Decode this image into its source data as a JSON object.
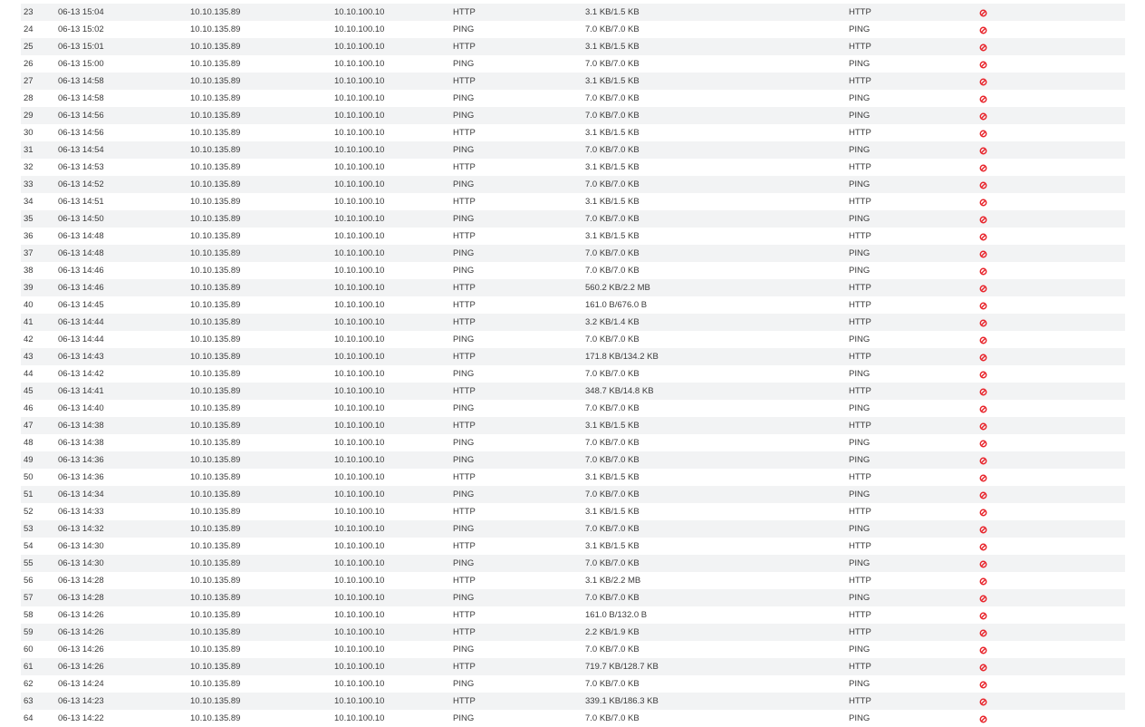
{
  "colors": {
    "stripe": "#f2f3f4",
    "text": "#3a3a3a",
    "blocked_icon": "#e8242b"
  },
  "icons": {
    "action": "blocked-icon"
  },
  "rows": [
    {
      "idx": "23",
      "time": "06-13 15:04",
      "src": "10.10.135.89",
      "dst": "10.10.100.10",
      "protocol": "HTTP",
      "bytes": "3.1 KB/1.5 KB",
      "app": "HTTP"
    },
    {
      "idx": "24",
      "time": "06-13 15:02",
      "src": "10.10.135.89",
      "dst": "10.10.100.10",
      "protocol": "PING",
      "bytes": "7.0 KB/7.0 KB",
      "app": "PING"
    },
    {
      "idx": "25",
      "time": "06-13 15:01",
      "src": "10.10.135.89",
      "dst": "10.10.100.10",
      "protocol": "HTTP",
      "bytes": "3.1 KB/1.5 KB",
      "app": "HTTP"
    },
    {
      "idx": "26",
      "time": "06-13 15:00",
      "src": "10.10.135.89",
      "dst": "10.10.100.10",
      "protocol": "PING",
      "bytes": "7.0 KB/7.0 KB",
      "app": "PING"
    },
    {
      "idx": "27",
      "time": "06-13 14:58",
      "src": "10.10.135.89",
      "dst": "10.10.100.10",
      "protocol": "HTTP",
      "bytes": "3.1 KB/1.5 KB",
      "app": "HTTP"
    },
    {
      "idx": "28",
      "time": "06-13 14:58",
      "src": "10.10.135.89",
      "dst": "10.10.100.10",
      "protocol": "PING",
      "bytes": "7.0 KB/7.0 KB",
      "app": "PING"
    },
    {
      "idx": "29",
      "time": "06-13 14:56",
      "src": "10.10.135.89",
      "dst": "10.10.100.10",
      "protocol": "PING",
      "bytes": "7.0 KB/7.0 KB",
      "app": "PING"
    },
    {
      "idx": "30",
      "time": "06-13 14:56",
      "src": "10.10.135.89",
      "dst": "10.10.100.10",
      "protocol": "HTTP",
      "bytes": "3.1 KB/1.5 KB",
      "app": "HTTP"
    },
    {
      "idx": "31",
      "time": "06-13 14:54",
      "src": "10.10.135.89",
      "dst": "10.10.100.10",
      "protocol": "PING",
      "bytes": "7.0 KB/7.0 KB",
      "app": "PING"
    },
    {
      "idx": "32",
      "time": "06-13 14:53",
      "src": "10.10.135.89",
      "dst": "10.10.100.10",
      "protocol": "HTTP",
      "bytes": "3.1 KB/1.5 KB",
      "app": "HTTP"
    },
    {
      "idx": "33",
      "time": "06-13 14:52",
      "src": "10.10.135.89",
      "dst": "10.10.100.10",
      "protocol": "PING",
      "bytes": "7.0 KB/7.0 KB",
      "app": "PING"
    },
    {
      "idx": "34",
      "time": "06-13 14:51",
      "src": "10.10.135.89",
      "dst": "10.10.100.10",
      "protocol": "HTTP",
      "bytes": "3.1 KB/1.5 KB",
      "app": "HTTP"
    },
    {
      "idx": "35",
      "time": "06-13 14:50",
      "src": "10.10.135.89",
      "dst": "10.10.100.10",
      "protocol": "PING",
      "bytes": "7.0 KB/7.0 KB",
      "app": "PING"
    },
    {
      "idx": "36",
      "time": "06-13 14:48",
      "src": "10.10.135.89",
      "dst": "10.10.100.10",
      "protocol": "HTTP",
      "bytes": "3.1 KB/1.5 KB",
      "app": "HTTP"
    },
    {
      "idx": "37",
      "time": "06-13 14:48",
      "src": "10.10.135.89",
      "dst": "10.10.100.10",
      "protocol": "PING",
      "bytes": "7.0 KB/7.0 KB",
      "app": "PING"
    },
    {
      "idx": "38",
      "time": "06-13 14:46",
      "src": "10.10.135.89",
      "dst": "10.10.100.10",
      "protocol": "PING",
      "bytes": "7.0 KB/7.0 KB",
      "app": "PING"
    },
    {
      "idx": "39",
      "time": "06-13 14:46",
      "src": "10.10.135.89",
      "dst": "10.10.100.10",
      "protocol": "HTTP",
      "bytes": "560.2 KB/2.2 MB",
      "app": "HTTP"
    },
    {
      "idx": "40",
      "time": "06-13 14:45",
      "src": "10.10.135.89",
      "dst": "10.10.100.10",
      "protocol": "HTTP",
      "bytes": "161.0 B/676.0 B",
      "app": "HTTP"
    },
    {
      "idx": "41",
      "time": "06-13 14:44",
      "src": "10.10.135.89",
      "dst": "10.10.100.10",
      "protocol": "HTTP",
      "bytes": "3.2 KB/1.4 KB",
      "app": "HTTP"
    },
    {
      "idx": "42",
      "time": "06-13 14:44",
      "src": "10.10.135.89",
      "dst": "10.10.100.10",
      "protocol": "PING",
      "bytes": "7.0 KB/7.0 KB",
      "app": "PING"
    },
    {
      "idx": "43",
      "time": "06-13 14:43",
      "src": "10.10.135.89",
      "dst": "10.10.100.10",
      "protocol": "HTTP",
      "bytes": "171.8 KB/134.2 KB",
      "app": "HTTP"
    },
    {
      "idx": "44",
      "time": "06-13 14:42",
      "src": "10.10.135.89",
      "dst": "10.10.100.10",
      "protocol": "PING",
      "bytes": "7.0 KB/7.0 KB",
      "app": "PING"
    },
    {
      "idx": "45",
      "time": "06-13 14:41",
      "src": "10.10.135.89",
      "dst": "10.10.100.10",
      "protocol": "HTTP",
      "bytes": "348.7 KB/14.8 KB",
      "app": "HTTP"
    },
    {
      "idx": "46",
      "time": "06-13 14:40",
      "src": "10.10.135.89",
      "dst": "10.10.100.10",
      "protocol": "PING",
      "bytes": "7.0 KB/7.0 KB",
      "app": "PING"
    },
    {
      "idx": "47",
      "time": "06-13 14:38",
      "src": "10.10.135.89",
      "dst": "10.10.100.10",
      "protocol": "HTTP",
      "bytes": "3.1 KB/1.5 KB",
      "app": "HTTP"
    },
    {
      "idx": "48",
      "time": "06-13 14:38",
      "src": "10.10.135.89",
      "dst": "10.10.100.10",
      "protocol": "PING",
      "bytes": "7.0 KB/7.0 KB",
      "app": "PING"
    },
    {
      "idx": "49",
      "time": "06-13 14:36",
      "src": "10.10.135.89",
      "dst": "10.10.100.10",
      "protocol": "PING",
      "bytes": "7.0 KB/7.0 KB",
      "app": "PING"
    },
    {
      "idx": "50",
      "time": "06-13 14:36",
      "src": "10.10.135.89",
      "dst": "10.10.100.10",
      "protocol": "HTTP",
      "bytes": "3.1 KB/1.5 KB",
      "app": "HTTP"
    },
    {
      "idx": "51",
      "time": "06-13 14:34",
      "src": "10.10.135.89",
      "dst": "10.10.100.10",
      "protocol": "PING",
      "bytes": "7.0 KB/7.0 KB",
      "app": "PING"
    },
    {
      "idx": "52",
      "time": "06-13 14:33",
      "src": "10.10.135.89",
      "dst": "10.10.100.10",
      "protocol": "HTTP",
      "bytes": "3.1 KB/1.5 KB",
      "app": "HTTP"
    },
    {
      "idx": "53",
      "time": "06-13 14:32",
      "src": "10.10.135.89",
      "dst": "10.10.100.10",
      "protocol": "PING",
      "bytes": "7.0 KB/7.0 KB",
      "app": "PING"
    },
    {
      "idx": "54",
      "time": "06-13 14:30",
      "src": "10.10.135.89",
      "dst": "10.10.100.10",
      "protocol": "HTTP",
      "bytes": "3.1 KB/1.5 KB",
      "app": "HTTP"
    },
    {
      "idx": "55",
      "time": "06-13 14:30",
      "src": "10.10.135.89",
      "dst": "10.10.100.10",
      "protocol": "PING",
      "bytes": "7.0 KB/7.0 KB",
      "app": "PING"
    },
    {
      "idx": "56",
      "time": "06-13 14:28",
      "src": "10.10.135.89",
      "dst": "10.10.100.10",
      "protocol": "HTTP",
      "bytes": "3.1 KB/2.2 MB",
      "app": "HTTP"
    },
    {
      "idx": "57",
      "time": "06-13 14:28",
      "src": "10.10.135.89",
      "dst": "10.10.100.10",
      "protocol": "PING",
      "bytes": "7.0 KB/7.0 KB",
      "app": "PING"
    },
    {
      "idx": "58",
      "time": "06-13 14:26",
      "src": "10.10.135.89",
      "dst": "10.10.100.10",
      "protocol": "HTTP",
      "bytes": "161.0 B/132.0 B",
      "app": "HTTP"
    },
    {
      "idx": "59",
      "time": "06-13 14:26",
      "src": "10.10.135.89",
      "dst": "10.10.100.10",
      "protocol": "HTTP",
      "bytes": "2.2 KB/1.9 KB",
      "app": "HTTP"
    },
    {
      "idx": "60",
      "time": "06-13 14:26",
      "src": "10.10.135.89",
      "dst": "10.10.100.10",
      "protocol": "PING",
      "bytes": "7.0 KB/7.0 KB",
      "app": "PING"
    },
    {
      "idx": "61",
      "time": "06-13 14:26",
      "src": "10.10.135.89",
      "dst": "10.10.100.10",
      "protocol": "HTTP",
      "bytes": "719.7 KB/128.7 KB",
      "app": "HTTP"
    },
    {
      "idx": "62",
      "time": "06-13 14:24",
      "src": "10.10.135.89",
      "dst": "10.10.100.10",
      "protocol": "PING",
      "bytes": "7.0 KB/7.0 KB",
      "app": "PING"
    },
    {
      "idx": "63",
      "time": "06-13 14:23",
      "src": "10.10.135.89",
      "dst": "10.10.100.10",
      "protocol": "HTTP",
      "bytes": "339.1 KB/186.3 KB",
      "app": "HTTP"
    },
    {
      "idx": "64",
      "time": "06-13 14:22",
      "src": "10.10.135.89",
      "dst": "10.10.100.10",
      "protocol": "PING",
      "bytes": "7.0 KB/7.0 KB",
      "app": "PING"
    }
  ]
}
